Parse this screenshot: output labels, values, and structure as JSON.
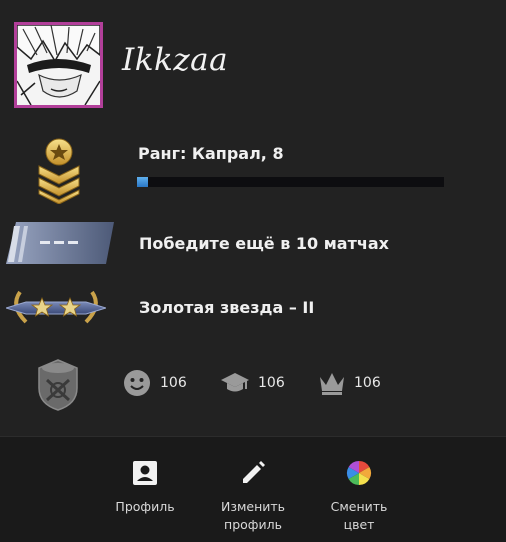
{
  "profile": {
    "username": "Ikkzaa"
  },
  "rank": {
    "label": "Ранг: Капрал, 8",
    "xp_progress_fraction": 0.035
  },
  "wins": {
    "label": "Победите ещё в 10 матчах"
  },
  "profile_rank": {
    "label": "Золотая звезда – II"
  },
  "stats": {
    "friendly": "106",
    "teacher": "106",
    "leader": "106"
  },
  "actions": {
    "profile": "Профиль",
    "edit_profile": "Изменить\nпрофиль",
    "change_color": "Сменить\nцвет"
  },
  "colors": {
    "avatar_border": "#b23f9a",
    "xp_fill": "#3f8fd8",
    "background": "#222222",
    "bottom_bar": "#1a1a1a"
  },
  "icons": {
    "rank": "gold-chevron-star-icon",
    "wins": "skill-group-banner-icon",
    "profile_rank": "gold-star-laurel-icon",
    "medal": "service-medal-icon",
    "friendly": "smiley-icon",
    "teacher": "graduation-cap-icon",
    "leader": "crown-icon",
    "profile": "account-box-icon",
    "edit": "pencil-icon",
    "color": "color-wheel-icon"
  }
}
